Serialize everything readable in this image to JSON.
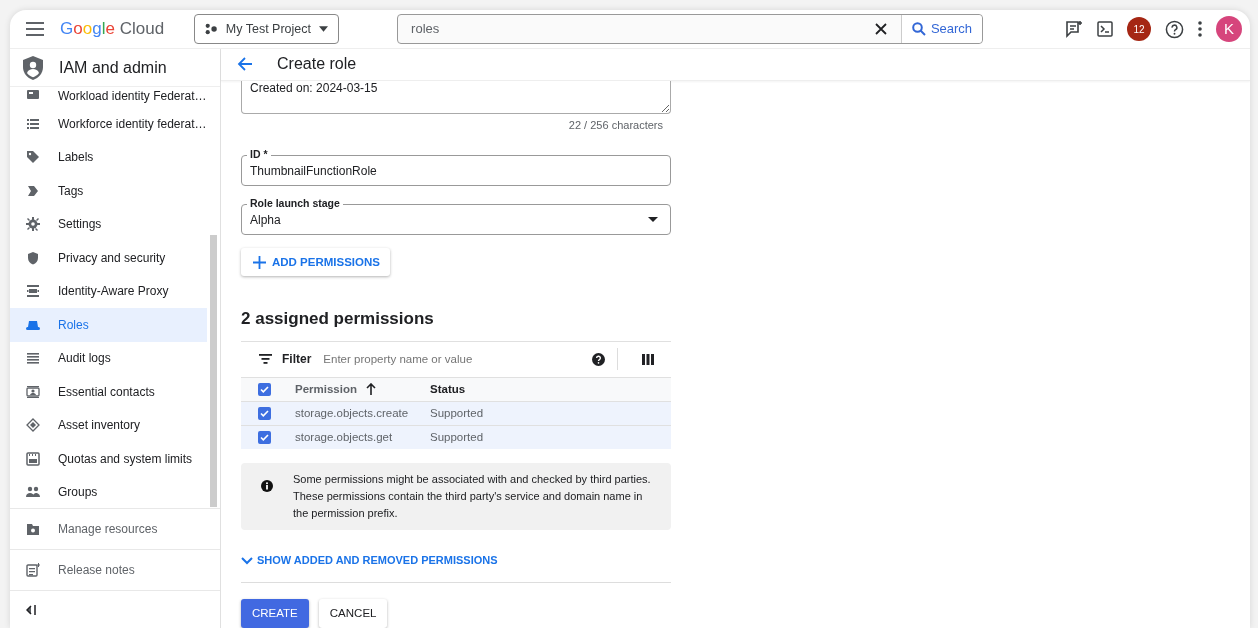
{
  "header": {
    "logo": "Google Cloud",
    "project": "My Test Project",
    "search": {
      "value": "roles",
      "button": "Search"
    },
    "notifications": "12",
    "avatar": "K"
  },
  "sidebar": {
    "title": "IAM and admin",
    "items": [
      {
        "label": "Workload identity Federat…",
        "selected": false
      },
      {
        "label": "Workforce identity federat…",
        "selected": false
      },
      {
        "label": "Labels",
        "selected": false
      },
      {
        "label": "Tags",
        "selected": false
      },
      {
        "label": "Settings",
        "selected": false
      },
      {
        "label": "Privacy and security",
        "selected": false
      },
      {
        "label": "Identity-Aware Proxy",
        "selected": false
      },
      {
        "label": "Roles",
        "selected": true
      },
      {
        "label": "Audit logs",
        "selected": false
      },
      {
        "label": "Essential contacts",
        "selected": false
      },
      {
        "label": "Asset inventory",
        "selected": false
      },
      {
        "label": "Quotas and system limits",
        "selected": false
      },
      {
        "label": "Groups",
        "selected": false
      }
    ],
    "footer_items": [
      {
        "label": "Manage resources"
      },
      {
        "label": "Release notes"
      }
    ]
  },
  "main": {
    "title": "Create role",
    "description": {
      "value": "Created on: 2024-03-15",
      "counter": "22 / 256 characters"
    },
    "id_field": {
      "label": "ID *",
      "value": "ThumbnailFunctionRole"
    },
    "launch_stage": {
      "label": "Role launch stage",
      "value": "Alpha"
    },
    "add_button": "ADD PERMISSIONS",
    "permissions": {
      "heading": "2 assigned permissions",
      "filter": {
        "label": "Filter",
        "placeholder": "Enter property name or value"
      },
      "columns": [
        "Permission",
        "Status"
      ],
      "all_checked": true,
      "rows": [
        {
          "permission": "storage.objects.create",
          "status": "Supported",
          "checked": true
        },
        {
          "permission": "storage.objects.get",
          "status": "Supported",
          "checked": true
        }
      ]
    },
    "info": "Some permissions might be associated with and checked by third parties. These permissions contain the third party's service and domain name in the permission prefix.",
    "toggle": "SHOW ADDED AND REMOVED PERMISSIONS",
    "buttons": [
      {
        "label": "CREATE",
        "kind": "primary"
      },
      {
        "label": "CANCEL",
        "kind": "secondary"
      }
    ]
  }
}
